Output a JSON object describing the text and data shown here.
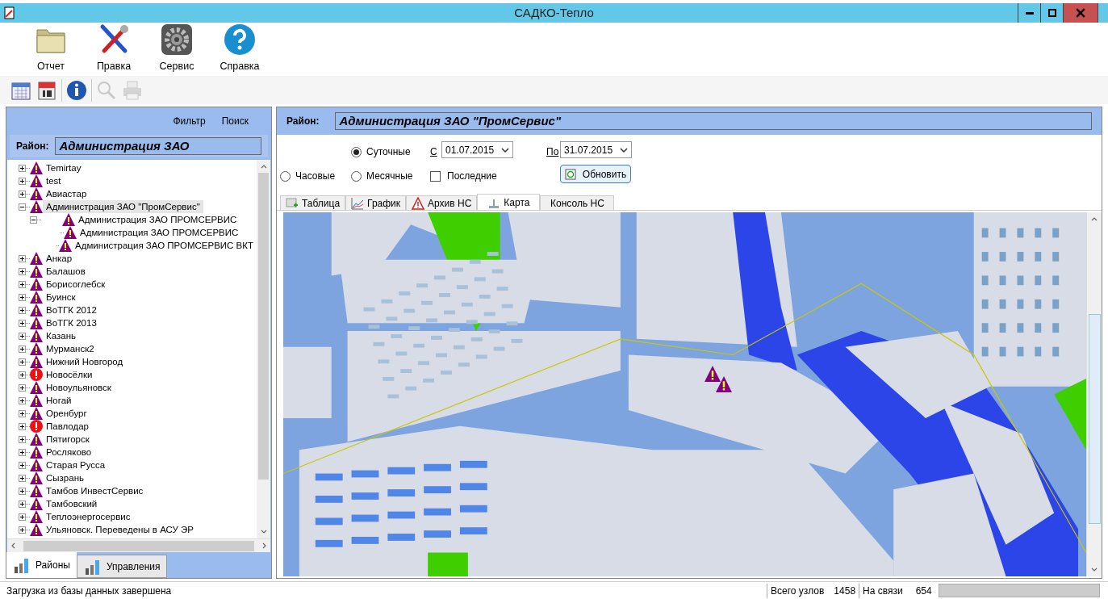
{
  "window": {
    "title": "САДКО-Тепло"
  },
  "main_toolbar": [
    {
      "label": "Отчет",
      "kind": "folder"
    },
    {
      "label": "Правка",
      "kind": "tools"
    },
    {
      "label": "Сервис",
      "kind": "gear"
    },
    {
      "label": "Справка",
      "kind": "help"
    }
  ],
  "quick_toolbar": [
    {
      "kind": "calendar",
      "disabled": false
    },
    {
      "kind": "day",
      "disabled": false
    },
    {
      "kind": "info",
      "disabled": false
    },
    {
      "kind": "search",
      "disabled": true
    },
    {
      "kind": "print",
      "disabled": true
    }
  ],
  "left_panel": {
    "links": [
      "Фильтр",
      "Поиск"
    ],
    "district_label": "Район:",
    "district_value": "Администрация ЗАО",
    "tree": [
      {
        "label": "Temirtay",
        "kind": "warning",
        "expanded": false,
        "selected": false
      },
      {
        "label": "test",
        "kind": "warning",
        "expanded": false,
        "selected": false
      },
      {
        "label": "Авиастар",
        "kind": "warning",
        "expanded": false,
        "selected": false
      },
      {
        "label": "Администрация ЗАО \"ПромСервис\"",
        "kind": "warning",
        "expanded": true,
        "selected": true,
        "children": [
          {
            "label": "Администрация ЗАО ПРОМСЕРВИС",
            "kind": "warning",
            "expanded": true,
            "selected": false,
            "children": [
              {
                "label": "Администрация ЗАО ПРОМСЕРВИС",
                "kind": "warning",
                "selected": false
              },
              {
                "label": "Администрация ЗАО ПРОМСЕРВИС ВКТ",
                "kind": "warning",
                "selected": false
              }
            ]
          }
        ]
      },
      {
        "label": "Анкар",
        "kind": "warning",
        "expanded": false,
        "selected": false
      },
      {
        "label": "Балашов",
        "kind": "warning",
        "expanded": false,
        "selected": false
      },
      {
        "label": "Борисоглебск",
        "kind": "warning",
        "expanded": false,
        "selected": false
      },
      {
        "label": "Буинск",
        "kind": "warning",
        "expanded": false,
        "selected": false
      },
      {
        "label": "ВоТГК 2012",
        "kind": "warning",
        "expanded": false,
        "selected": false
      },
      {
        "label": "ВоТГК 2013",
        "kind": "warning",
        "expanded": false,
        "selected": false
      },
      {
        "label": "Казань",
        "kind": "warning",
        "expanded": false,
        "selected": false
      },
      {
        "label": "Мурманск2",
        "kind": "warning",
        "expanded": false,
        "selected": false
      },
      {
        "label": "Нижний Новгород",
        "kind": "warning",
        "expanded": false,
        "selected": false
      },
      {
        "label": "Новосёлки",
        "kind": "error",
        "expanded": false,
        "selected": false
      },
      {
        "label": "Новоульяновск",
        "kind": "warning",
        "expanded": false,
        "selected": false
      },
      {
        "label": "Ногай",
        "kind": "warning",
        "expanded": false,
        "selected": false
      },
      {
        "label": "Оренбург",
        "kind": "warning",
        "expanded": false,
        "selected": false
      },
      {
        "label": "Павлодар",
        "kind": "error",
        "expanded": false,
        "selected": false
      },
      {
        "label": "Пятигорск",
        "kind": "warning",
        "expanded": false,
        "selected": false
      },
      {
        "label": "Росляково",
        "kind": "warning",
        "expanded": false,
        "selected": false
      },
      {
        "label": "Старая Русса",
        "kind": "warning",
        "expanded": false,
        "selected": false
      },
      {
        "label": "Сызрань",
        "kind": "warning",
        "expanded": false,
        "selected": false
      },
      {
        "label": "Тамбов ИнвестСервис",
        "kind": "warning",
        "expanded": false,
        "selected": false
      },
      {
        "label": "Тамбовский",
        "kind": "warning",
        "expanded": false,
        "selected": false
      },
      {
        "label": "Теплоэнергосервис",
        "kind": "warning",
        "expanded": false,
        "selected": false
      },
      {
        "label": "Ульяновск. Переведены в АСУ ЭР",
        "kind": "warning",
        "expanded": false,
        "selected": false
      }
    ],
    "bottom_tabs": [
      {
        "label": "Районы",
        "selected": true
      },
      {
        "label": "Управления",
        "selected": false
      }
    ]
  },
  "right_panel": {
    "district_label": "Район:",
    "district_value": "Администрация ЗАО \"ПромСервис\"",
    "periods": [
      {
        "label": "Часовые",
        "selected": false
      },
      {
        "label": "Суточные",
        "selected": true
      },
      {
        "label": "Месячные",
        "selected": false
      }
    ],
    "from_label": "С",
    "from_value": "01.07.2015",
    "to_label": "По",
    "to_value": "31.07.2015",
    "last": {
      "label": "Последние",
      "checked": false
    },
    "refresh_button": "Обновить",
    "tabs": [
      {
        "label": "Таблица",
        "kind": "table",
        "selected": false
      },
      {
        "label": "График",
        "kind": "chart",
        "selected": false
      },
      {
        "label": "Архив НС",
        "kind": "alarm",
        "selected": false
      },
      {
        "label": "Карта",
        "kind": "map",
        "selected": true
      },
      {
        "label": "Консоль НС",
        "kind": "none",
        "selected": false
      }
    ]
  },
  "status_bar": {
    "message": "Загрузка из базы данных завершена",
    "total_label": "Всего узлов",
    "total_value": "1458",
    "online_label": "На связи",
    "online_value": "654"
  }
}
